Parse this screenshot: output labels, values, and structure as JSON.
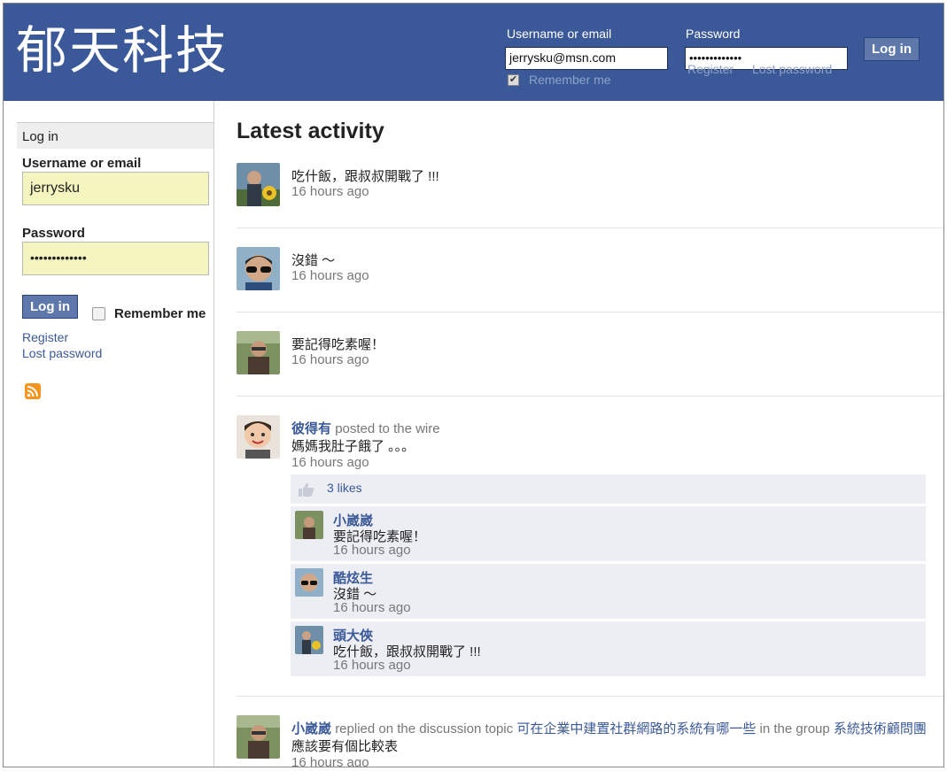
{
  "header": {
    "brand": "郁天科技",
    "username_label": "Username or email",
    "username_value": "jerrysku@msn.com",
    "password_label": "Password",
    "password_value": "•••••••••••••",
    "remember_label": "Remember me",
    "register_link": "Register",
    "lost_password_link": "Lost password",
    "login_button": "Log in"
  },
  "sidebar": {
    "heading": "Log in",
    "username_label": "Username or email",
    "username_value": "jerrysku",
    "password_label": "Password",
    "password_value": "•••••••••••••",
    "login_button": "Log in",
    "remember_label": "Remember me",
    "register_link": "Register",
    "lost_password_link": "Lost password",
    "rss_icon": "rss-icon"
  },
  "main": {
    "title": "Latest activity",
    "items": [
      {
        "text": "吃什飯，跟叔叔開戰了 !!!",
        "time": "16 hours ago",
        "avatar": "man-sunflower"
      },
      {
        "text": "沒錯 ～",
        "time": "16 hours ago",
        "avatar": "boy-sunglasses"
      },
      {
        "text": "要記得吃素喔！",
        "time": "16 hours ago",
        "avatar": "man-field"
      },
      {
        "author": "彼得有",
        "action": "posted to the wire",
        "text": "媽媽我肚子餓了 。。。",
        "time": "16 hours ago",
        "avatar": "child-smiling",
        "likes": "3 likes",
        "comments": [
          {
            "author": "小崴崴",
            "text": "要記得吃素喔！",
            "time": "16 hours ago",
            "avatar": "man-field"
          },
          {
            "author": "酷炫生",
            "text": "沒錯 ～",
            "time": "16 hours ago",
            "avatar": "boy-sunglasses"
          },
          {
            "author": "頭大俠",
            "text": "吃什飯，跟叔叔開戰了 !!!",
            "time": "16 hours ago",
            "avatar": "man-sunflower"
          }
        ]
      },
      {
        "author": "小崴崴",
        "action_prefix": "replied on the discussion topic",
        "topic": "可在企業中建置社群網路的系統有哪一些",
        "action_middle": "in the group",
        "group": "系統技術顧問團",
        "text": "應該要有個比較表",
        "time": "16 hours ago",
        "avatar": "man-field"
      }
    ]
  },
  "colors": {
    "brand_blue": "#3b5998",
    "field_yellow": "#f5f5c0",
    "comment_bg": "#eceef3"
  }
}
